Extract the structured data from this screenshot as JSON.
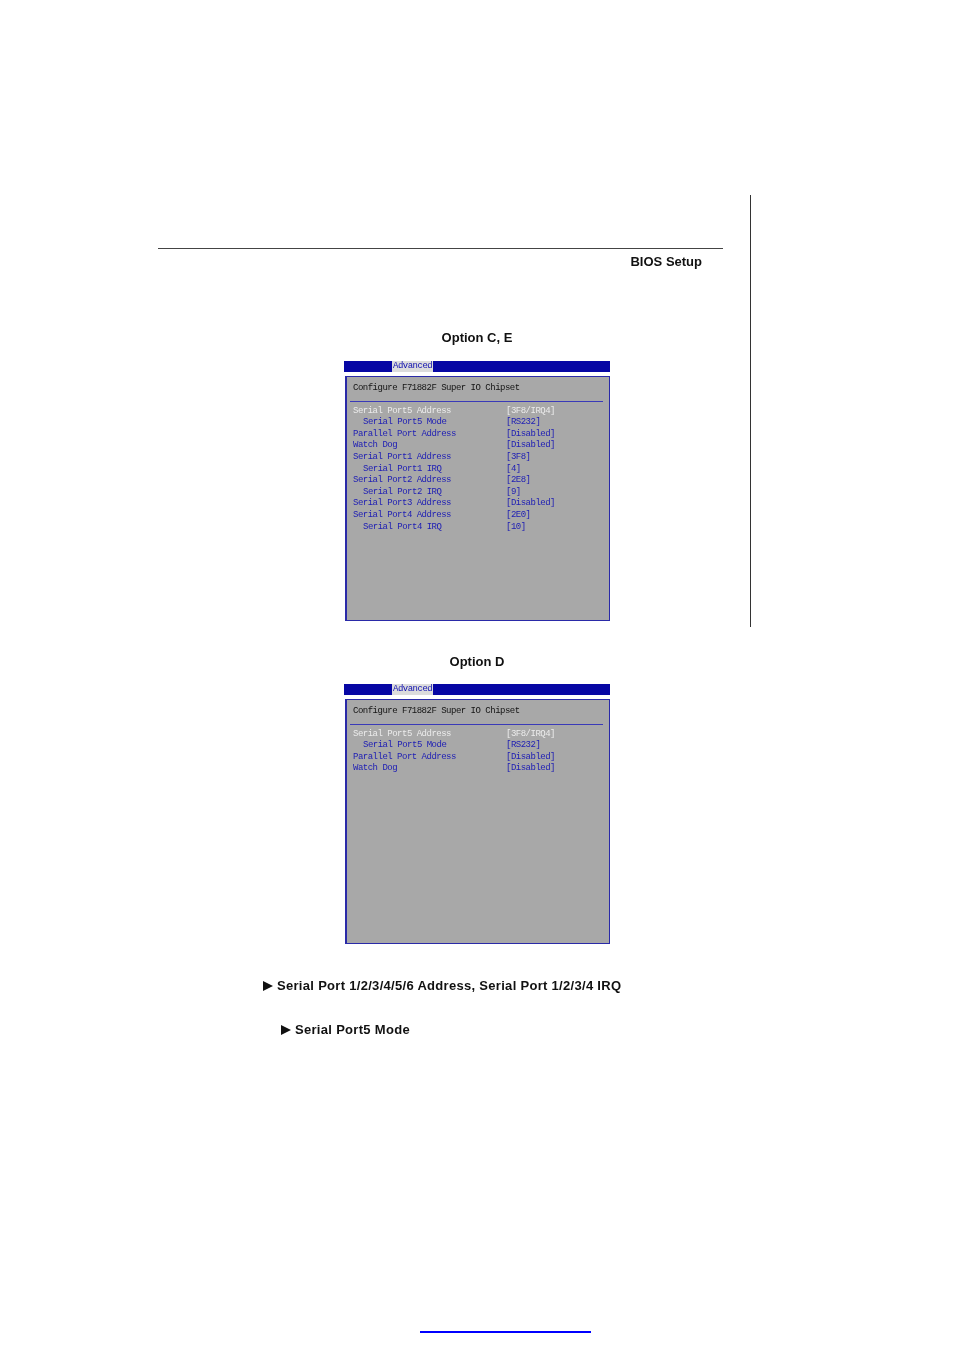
{
  "header": {
    "title": "BIOS Setup"
  },
  "sections": [
    {
      "caption": "Option C, E",
      "screen": {
        "tabs": [
          {
            "label": "Advanced",
            "selected": true
          }
        ],
        "title": "Configure F71882F Super IO Chipset",
        "items": [
          {
            "label": "Serial Port5 Address",
            "value": "[3F8/IRQ4]",
            "disabled": true,
            "children": [
              {
                "label": "Serial Port5 Mode",
                "value": "[RS232]",
                "disabled": false
              }
            ]
          },
          {
            "label": "Parallel Port Address",
            "value": "[Disabled]",
            "disabled": false
          },
          {
            "label": "Watch Dog",
            "value": "[Disabled]",
            "disabled": false
          },
          {
            "label": "Serial Port1 Address",
            "value": "[3F8]",
            "disabled": false,
            "children": [
              {
                "label": "Serial Port1 IRQ",
                "value": "[4]",
                "disabled": false
              }
            ]
          },
          {
            "label": "Serial Port2 Address",
            "value": "[2E8]",
            "disabled": false,
            "children": [
              {
                "label": "Serial Port2 IRQ",
                "value": "[9]",
                "disabled": false
              }
            ]
          },
          {
            "label": "Serial Port3 Address",
            "value": "[Disabled]",
            "disabled": false
          },
          {
            "label": "Serial Port4 Address",
            "value": "[2E0]",
            "disabled": false,
            "children": [
              {
                "label": "Serial Port4 IRQ",
                "value": "[10]",
                "disabled": false
              }
            ]
          }
        ]
      }
    },
    {
      "caption": "Option D",
      "screen": {
        "tabs": [
          {
            "label": "Advanced",
            "selected": true
          }
        ],
        "title": "Configure F71882F Super IO Chipset",
        "items": [
          {
            "label": "Serial Port5 Address",
            "value": "[3F8/IRQ4]",
            "disabled": true,
            "children": [
              {
                "label": "Serial Port5 Mode",
                "value": "[RS232]",
                "disabled": false
              }
            ]
          },
          {
            "label": "Parallel Port Address",
            "value": "[Disabled]",
            "disabled": false
          },
          {
            "label": "Watch Dog",
            "value": "[Disabled]",
            "disabled": false
          }
        ]
      }
    }
  ],
  "topics": [
    {
      "label": "Serial Port 1/2/3/4/5/6 Address, Serial Port 1/2/3/4 IRQ",
      "children": [
        {
          "label": "Serial Port5 Mode"
        }
      ]
    }
  ]
}
